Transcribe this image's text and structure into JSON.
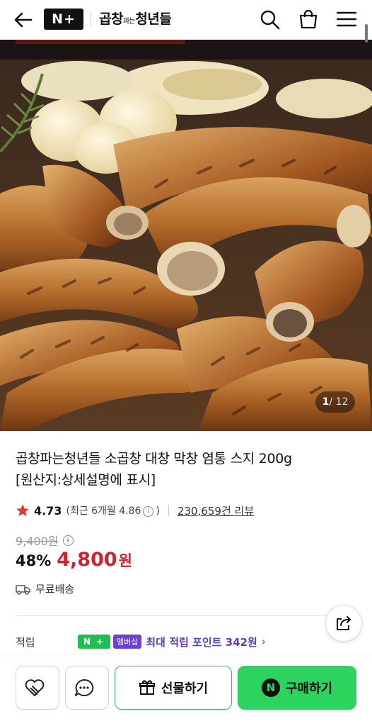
{
  "header": {
    "logo_text": "N+",
    "store_prefix": "곱창",
    "store_small": "파는",
    "store_suffix": "청년들"
  },
  "hero": {
    "page_current": "1",
    "page_total": "/ 12"
  },
  "product": {
    "title_line1": "곱창파는청년들 소곱창 대창 막창 염통 스지 200g",
    "title_line2": "[원산지:상세설명에 표시]",
    "rating": "4.73",
    "recent_prefix": "(최근 6개월 4.86",
    "recent_suffix": ")",
    "reviews": "230,659건 리뷰",
    "original_price": "9,400원",
    "discount": "48%",
    "price": "4,800",
    "currency": "원",
    "shipping": "무료배송",
    "points_label": "적립",
    "npay_badge": "N +",
    "member_badge": "멤버십",
    "points_text": "최대 적립 포인트 342원",
    "points_chevron": "›"
  },
  "bottom": {
    "gift_label": "선물하기",
    "buy_label": "구매하기",
    "buy_icon_letter": "N"
  },
  "colors": {
    "accent_green": "#2dd35f",
    "price_red": "#d3202a",
    "member_purple": "#6c3fd6"
  }
}
